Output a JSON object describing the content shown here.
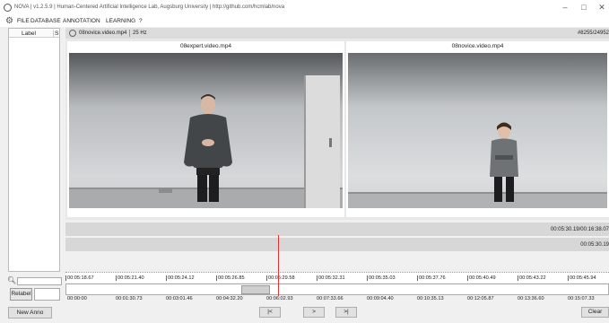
{
  "window": {
    "title": "NOVA | v1.2.5.9 | Human-Centered Artificial Intelligence Lab, Augsburg University | http://github.com/hcmlab/nova",
    "minimize": "–",
    "maximize": "□",
    "close": "✕"
  },
  "menu": {
    "items": [
      "FILE",
      "DATABASE",
      "ANNOTATION",
      "LEARNING",
      "?"
    ]
  },
  "annotation_list": {
    "col_label": "Label",
    "col_second": "S"
  },
  "search": {
    "value": ""
  },
  "relabel": {
    "button": "Relabel",
    "value": ""
  },
  "new_anno_button": "New Anno",
  "video_header": {
    "file": "08novice.video.mp4",
    "fps": "25 Hz",
    "frame": "#8255/24952"
  },
  "videos": [
    {
      "label": "08expert.video.mp4"
    },
    {
      "label": "08novice.video.mp4"
    }
  ],
  "tracks": {
    "time1": "00:05:30.19/00:16:38.07",
    "time2": "00:05:30.19"
  },
  "timeline": {
    "upper_ticks": [
      "00:05:18.67",
      "00:05:21.40",
      "00:05:24.12",
      "00:05:26.85",
      "00:05:29.58",
      "00:05:32.31",
      "00:05:35.03",
      "00:05:37.76",
      "00:05:40.49",
      "00:05:43.22",
      "00:05:45.94"
    ],
    "lower_ticks": [
      "00:00:00",
      "00:01:30.73",
      "00:03:01.46",
      "00:04:32.20",
      "00:06:02.93",
      "00:07:33.66",
      "00:09:04.40",
      "00:10:35.13",
      "00:12:05.87",
      "00:13:36.60",
      "00:15:07.33"
    ],
    "cursor_color": "#e33333"
  },
  "controls": {
    "prev": "|<",
    "play": ">",
    "next": ">|",
    "clear": "Clear"
  }
}
